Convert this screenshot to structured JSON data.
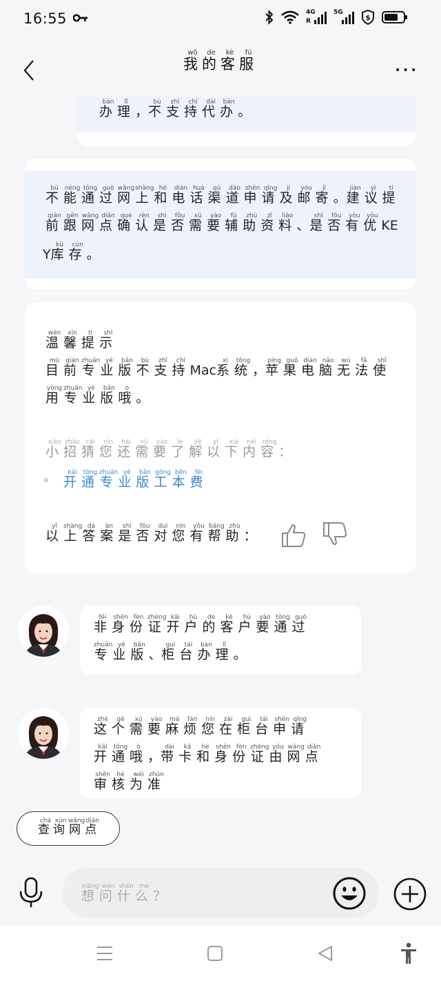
{
  "status": {
    "time": "16:55",
    "network_4g": "4G",
    "network_5g": "5G",
    "sub_r": "R"
  },
  "header": {
    "title": [
      [
        "wǒ",
        "我"
      ],
      [
        "de",
        "的"
      ],
      [
        "kè",
        "客"
      ],
      [
        "fú",
        "服"
      ]
    ],
    "more": "···"
  },
  "messages": {
    "partial_top": [
      [
        "bàn",
        "办"
      ],
      [
        "lǐ",
        "理"
      ],
      [
        "",
        "，"
      ],
      [
        "bù",
        "不"
      ],
      [
        "zhī",
        "支"
      ],
      [
        "chí",
        "持"
      ],
      [
        "dài",
        "代"
      ],
      [
        "bàn",
        "办"
      ],
      [
        "",
        "。"
      ]
    ],
    "card1": {
      "line1": [
        [
          "bù",
          "不"
        ],
        [
          "néng",
          "能"
        ],
        [
          "tōng",
          "通"
        ],
        [
          "guò",
          "过"
        ],
        [
          "wǎng",
          "网"
        ],
        [
          "shàng",
          "上"
        ],
        [
          "hé",
          "和"
        ],
        [
          "diàn",
          "电"
        ],
        [
          "huà",
          "话"
        ],
        [
          "qú",
          "渠"
        ],
        [
          "dào",
          "道"
        ],
        [
          "shēn",
          "申"
        ],
        [
          "qǐng",
          "请"
        ],
        [
          "jí",
          "及"
        ],
        [
          "yóu",
          "邮"
        ],
        [
          "jì",
          "寄"
        ],
        [
          "",
          "。"
        ],
        [
          "jiàn",
          "建"
        ],
        [
          "yì",
          "议"
        ],
        [
          "tí",
          "提"
        ]
      ],
      "line2": [
        [
          "qián",
          "前"
        ],
        [
          "gēn",
          "跟"
        ],
        [
          "wǎng",
          "网"
        ],
        [
          "diǎn",
          "点"
        ],
        [
          "què",
          "确"
        ],
        [
          "rèn",
          "认"
        ],
        [
          "shì",
          "是"
        ],
        [
          "fǒu",
          "否"
        ],
        [
          "xū",
          "需"
        ],
        [
          "yào",
          "要"
        ],
        [
          "fǔ",
          "辅"
        ],
        [
          "zhù",
          "助"
        ],
        [
          "zī",
          "资"
        ],
        [
          "liào",
          "料"
        ],
        [
          "",
          "、"
        ],
        [
          "shì",
          "是"
        ],
        [
          "fǒu",
          "否"
        ],
        [
          "yǒu",
          "有"
        ],
        [
          "yōu",
          "优"
        ],
        [
          "",
          "KE"
        ]
      ],
      "line3": [
        [
          "",
          "Y"
        ],
        [
          "kù",
          "库"
        ],
        [
          "cún",
          "存"
        ],
        [
          "",
          "。"
        ]
      ]
    },
    "card2": {
      "tip": [
        [
          "wēn",
          "温"
        ],
        [
          "xīn",
          "馨"
        ],
        [
          "tí",
          "提"
        ],
        [
          "shì",
          "示"
        ]
      ],
      "line1": [
        [
          "mù",
          "目"
        ],
        [
          "qián",
          "前"
        ],
        [
          "zhuān",
          "专"
        ],
        [
          "yè",
          "业"
        ],
        [
          "bǎn",
          "版"
        ],
        [
          "bù",
          "不"
        ],
        [
          "zhī",
          "支"
        ],
        [
          "chí",
          "持"
        ],
        [
          "",
          "Mac"
        ],
        [
          "xì",
          "系"
        ],
        [
          "tǒng",
          "统"
        ],
        [
          "",
          "，"
        ],
        [
          "píng",
          "苹"
        ],
        [
          "guǒ",
          "果"
        ],
        [
          "diàn",
          "电"
        ],
        [
          "nǎo",
          "脑"
        ],
        [
          "wú",
          "无"
        ],
        [
          "fǎ",
          "法"
        ],
        [
          "shǐ",
          "使"
        ]
      ],
      "line2": [
        [
          "yòng",
          "用"
        ],
        [
          "zhuān",
          "专"
        ],
        [
          "yè",
          "业"
        ],
        [
          "bǎn",
          "版"
        ],
        [
          "ò",
          "哦"
        ],
        [
          "",
          "。"
        ]
      ],
      "guess": [
        [
          "xiǎo",
          "小"
        ],
        [
          "zhāo",
          "招"
        ],
        [
          "cāi",
          "猜"
        ],
        [
          "nín",
          "您"
        ],
        [
          "hái",
          "还"
        ],
        [
          "xū",
          "需"
        ],
        [
          "yào",
          "要"
        ],
        [
          "le",
          "了"
        ],
        [
          "jiě",
          "解"
        ],
        [
          "yǐ",
          "以"
        ],
        [
          "xià",
          "下"
        ],
        [
          "nèi",
          "内"
        ],
        [
          "róng",
          "容"
        ],
        [
          "",
          "："
        ]
      ],
      "link": [
        [
          "kāi",
          "开"
        ],
        [
          "tōng",
          "通"
        ],
        [
          "zhuān",
          "专"
        ],
        [
          "yè",
          "业"
        ],
        [
          "bǎn",
          "版"
        ],
        [
          "gōng",
          "工"
        ],
        [
          "běn",
          "本"
        ],
        [
          "fèi",
          "费"
        ]
      ],
      "helpful": [
        [
          "yǐ",
          "以"
        ],
        [
          "shàng",
          "上"
        ],
        [
          "dá",
          "答"
        ],
        [
          "àn",
          "案"
        ],
        [
          "shì",
          "是"
        ],
        [
          "fǒu",
          "否"
        ],
        [
          "duì",
          "对"
        ],
        [
          "nín",
          "您"
        ],
        [
          "yǒu",
          "有"
        ],
        [
          "bāng",
          "帮"
        ],
        [
          "zhù",
          "助"
        ],
        [
          "",
          "："
        ]
      ]
    },
    "bubble1": {
      "line1": [
        [
          "fēi",
          "非"
        ],
        [
          "shēn",
          "身"
        ],
        [
          "fèn",
          "份"
        ],
        [
          "zhèng",
          "证"
        ],
        [
          "kāi",
          "开"
        ],
        [
          "hù",
          "户"
        ],
        [
          "de",
          "的"
        ],
        [
          "kè",
          "客"
        ],
        [
          "hù",
          "户"
        ],
        [
          "yào",
          "要"
        ],
        [
          "tōng",
          "通"
        ],
        [
          "guò",
          "过"
        ]
      ],
      "line2": [
        [
          "zhuān",
          "专"
        ],
        [
          "yè",
          "业"
        ],
        [
          "bǎn",
          "版"
        ],
        [
          "",
          "、"
        ],
        [
          "guì",
          "柜"
        ],
        [
          "tái",
          "台"
        ],
        [
          "bàn",
          "办"
        ],
        [
          "lǐ",
          "理"
        ],
        [
          "",
          "。"
        ]
      ]
    },
    "bubble2": {
      "line1": [
        [
          "zhè",
          "这"
        ],
        [
          "gè",
          "个"
        ],
        [
          "xū",
          "需"
        ],
        [
          "yào",
          "要"
        ],
        [
          "má",
          "麻"
        ],
        [
          "fán",
          "烦"
        ],
        [
          "nín",
          "您"
        ],
        [
          "zài",
          "在"
        ],
        [
          "guì",
          "柜"
        ],
        [
          "tái",
          "台"
        ],
        [
          "shēn",
          "申"
        ],
        [
          "qǐng",
          "请"
        ]
      ],
      "line2": [
        [
          "kāi",
          "开"
        ],
        [
          "tōng",
          "通"
        ],
        [
          "ò",
          "哦"
        ],
        [
          "",
          "，"
        ],
        [
          "dài",
          "带"
        ],
        [
          "kǎ",
          "卡"
        ],
        [
          "hé",
          "和"
        ],
        [
          "shēn",
          "身"
        ],
        [
          "fèn",
          "份"
        ],
        [
          "zhèng",
          "证"
        ],
        [
          "yóu",
          "由"
        ],
        [
          "wǎng",
          "网"
        ],
        [
          "diǎn",
          "点"
        ]
      ],
      "line3": [
        [
          "shěn",
          "审"
        ],
        [
          "hé",
          "核"
        ],
        [
          "wéi",
          "为"
        ],
        [
          "zhǔn",
          "准"
        ]
      ]
    },
    "query_button": [
      [
        "chá",
        "查"
      ],
      [
        "xún",
        "询"
      ],
      [
        "wǎng",
        "网"
      ],
      [
        "diǎn",
        "点"
      ]
    ]
  },
  "input": {
    "placeholder": [
      [
        "xiǎng",
        "想"
      ],
      [
        "wèn",
        "问"
      ],
      [
        "shén",
        "什"
      ],
      [
        "me",
        "么"
      ],
      [
        "",
        "？"
      ]
    ]
  },
  "colors": {
    "background": "#f6f6f8",
    "card_highlight": "#eef3fb",
    "link": "#3a86d6",
    "muted": "#9a9a9a"
  }
}
